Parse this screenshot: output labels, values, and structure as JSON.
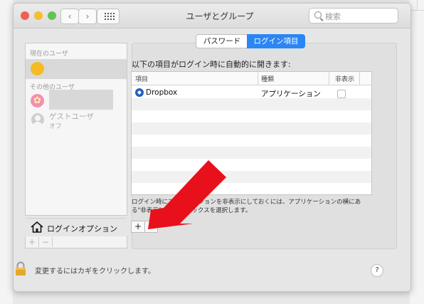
{
  "window": {
    "title": "ユーザとグループ",
    "search_placeholder": "検索"
  },
  "sidebar": {
    "current_users_label": "現在のユーザ",
    "other_users_label": "その他のユーザ",
    "guest_user_name": "ゲストユーザ",
    "guest_user_status": "オフ",
    "login_options_label": "ログインオプション",
    "add_symbol": "+",
    "remove_symbol": "−"
  },
  "tabs": {
    "password": "パスワード",
    "login_items": "ログイン項目",
    "selected": "login_items"
  },
  "login_items": {
    "intro": "以下の項目がログイン時に自動的に開きます:",
    "columns": [
      "項目",
      "種類",
      "非表示"
    ],
    "rows": [
      {
        "item": "Dropbox",
        "kind": "アプリケーション",
        "hidden": false
      }
    ],
    "note": "ログイン時にアプリケーションを非表示にしておくには、アプリケーションの横にある\"非表示\"チェックボックスを選択します。",
    "add_symbol": "+",
    "remove_symbol": "−"
  },
  "footer": {
    "lock_label": "変更するにはカギをクリックします。",
    "help_symbol": "?"
  },
  "colors": {
    "accent": "#2a86f4",
    "arrow": "#e8111b",
    "close": "#ee5f57",
    "minimize": "#f5bd30",
    "zoom": "#61c454"
  },
  "icons": [
    "back-icon",
    "forward-icon",
    "grid-icon",
    "search-icon",
    "user-avatar",
    "flower-avatar",
    "guest-icon",
    "house-icon",
    "dropbox-icon",
    "lock-icon",
    "help-icon",
    "arrow-annotation"
  ]
}
